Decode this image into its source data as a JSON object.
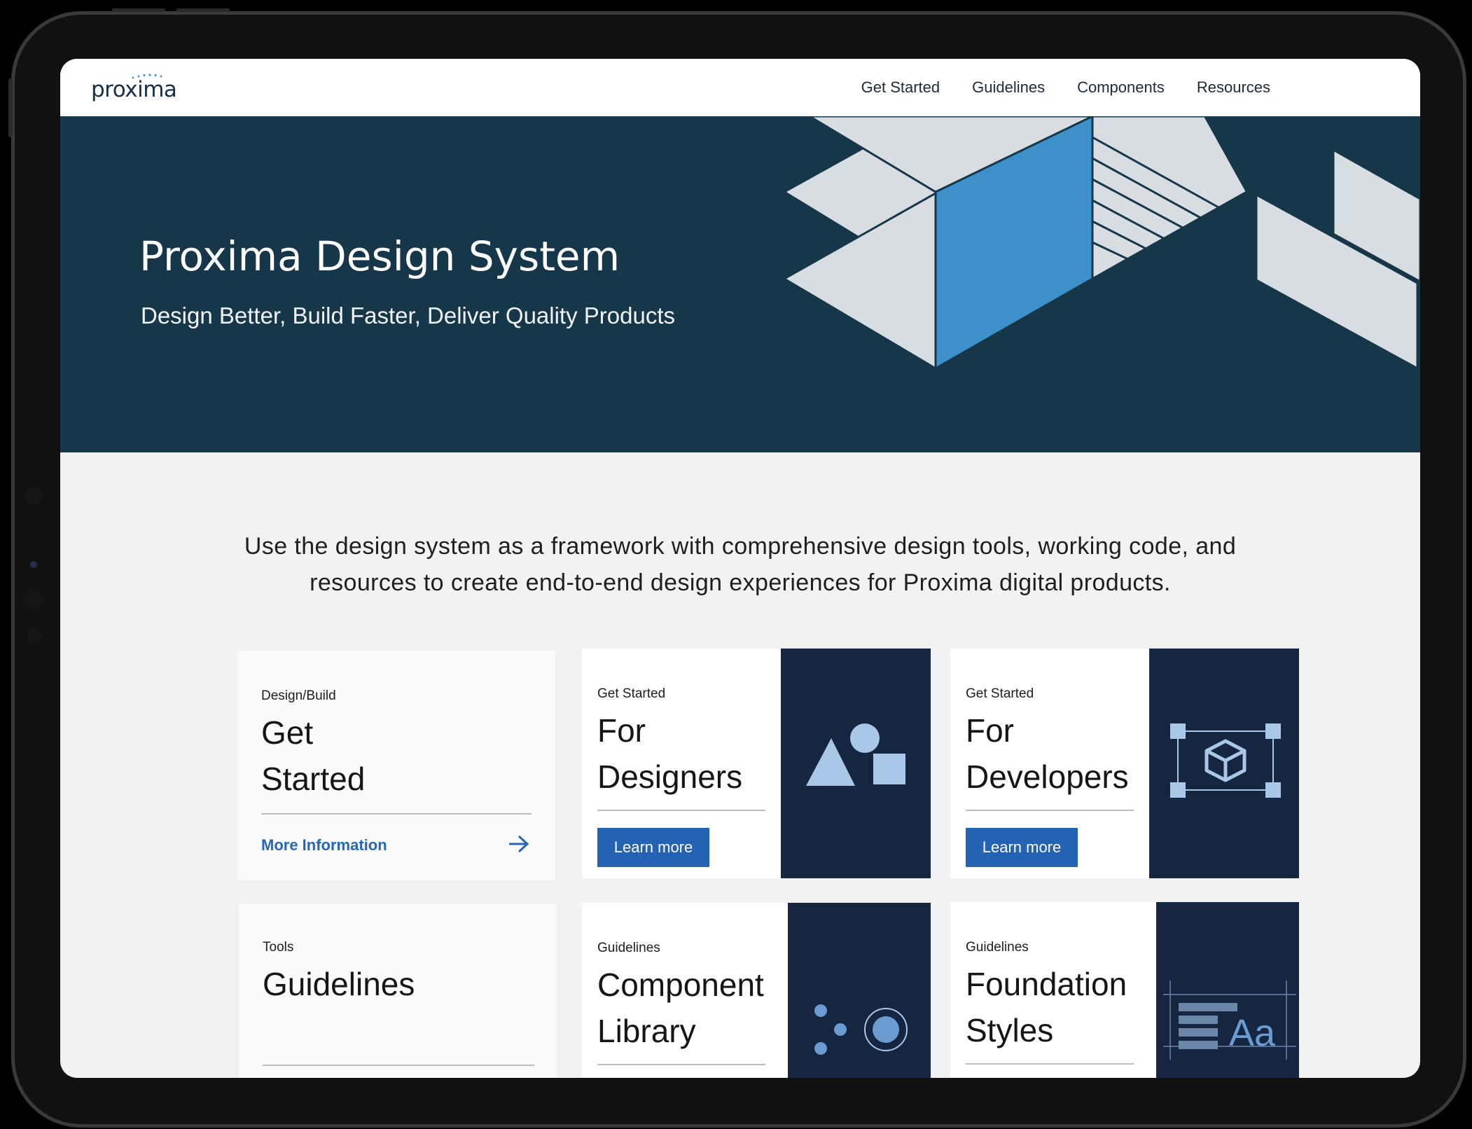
{
  "colors": {
    "navy_hero": "#163649",
    "navy_tile": "#162641",
    "accent_blue": "#2463b3",
    "link_blue": "#2468b9",
    "illustration_blue": "#3d90c9",
    "illustration_grey": "#d8dde1"
  },
  "nav": {
    "logo_text": "proxima",
    "links": [
      "Get Started",
      "Guidelines",
      "Components",
      "Resources"
    ]
  },
  "hero": {
    "title": "Proxima Design System",
    "subtitle": "Design Better, Build Faster, Deliver Quality Products"
  },
  "intro": {
    "line1": "Use the design system as a framework with comprehensive design tools, working code, and",
    "line2": "resources to create end-to-end design experiences for Proxima digital products."
  },
  "cards": [
    {
      "eyebrow": "Design/Build",
      "title_line1": "Get",
      "title_line2": "Started",
      "link": "More Information",
      "icon": "arrow-right-icon"
    },
    {
      "eyebrow": "Get Started",
      "title_line1": "For",
      "title_line2": "Designers",
      "button": "Learn more",
      "icon": "shapes-icon"
    },
    {
      "eyebrow": "Get Started",
      "title_line1": "For",
      "title_line2": "Developers",
      "button": "Learn more",
      "icon": "cube-icon"
    },
    {
      "eyebrow": "Tools",
      "title_line1": "Guidelines"
    },
    {
      "eyebrow": "Guidelines",
      "title_line1": "Component",
      "title_line2": "Library",
      "icon": "dots-icon"
    },
    {
      "eyebrow": "Guidelines",
      "title_line1": "Foundation",
      "title_line2": "Styles",
      "icon": "typography-icon",
      "icon_text": "Aa"
    }
  ]
}
